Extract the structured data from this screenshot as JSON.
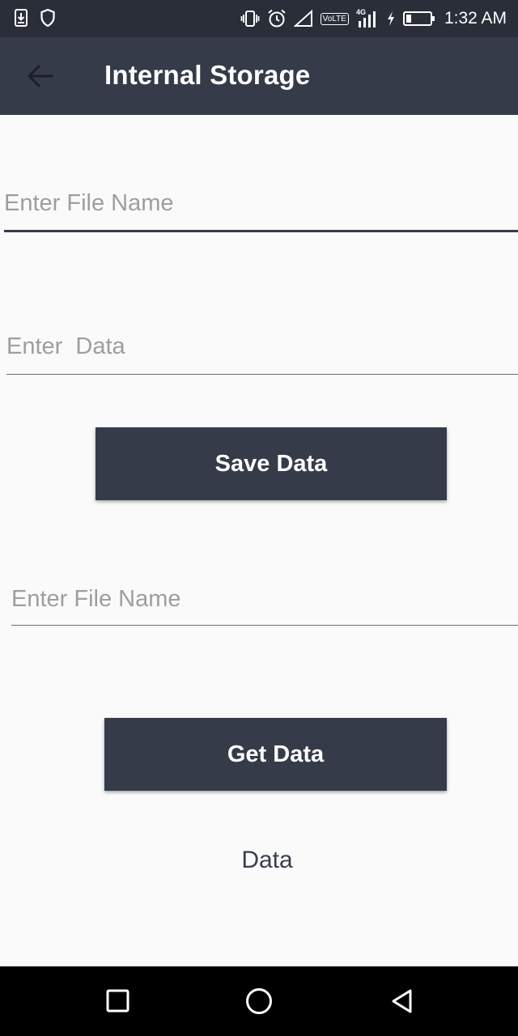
{
  "status_bar": {
    "time": "1:32 AM",
    "volte": "VoLTE",
    "network": "4G",
    "icons": [
      "download-notification-icon",
      "shield-icon",
      "vibrate-icon",
      "alarm-icon",
      "signal-icon",
      "volte-icon",
      "cell-signal-4g-icon",
      "charging-icon",
      "battery-icon"
    ]
  },
  "app_bar": {
    "title": "Internal Storage",
    "back_icon": "arrow-left-icon"
  },
  "form": {
    "file_name_placeholder": "Enter File Name",
    "data_placeholder": "Enter  Data",
    "save_button_label": "Save Data",
    "read_file_name_placeholder": "Enter File Name",
    "get_button_label": "Get Data",
    "result_text": "Data"
  },
  "nav_bar": {
    "icons": [
      "recents-square-icon",
      "home-circle-icon",
      "back-triangle-icon"
    ]
  },
  "colors": {
    "status_bar": "#2a2e38",
    "app_bar": "#363b4a",
    "button": "#363b4a",
    "background": "#fafafa",
    "placeholder": "#9e9e9e"
  }
}
